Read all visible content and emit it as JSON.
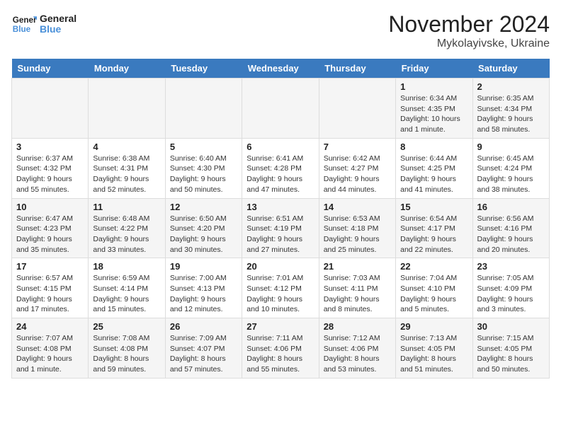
{
  "logo": {
    "text_general": "General",
    "text_blue": "Blue"
  },
  "header": {
    "month": "November 2024",
    "location": "Mykolayivske, Ukraine"
  },
  "days_of_week": [
    "Sunday",
    "Monday",
    "Tuesday",
    "Wednesday",
    "Thursday",
    "Friday",
    "Saturday"
  ],
  "weeks": [
    [
      {
        "day": "",
        "info": ""
      },
      {
        "day": "",
        "info": ""
      },
      {
        "day": "",
        "info": ""
      },
      {
        "day": "",
        "info": ""
      },
      {
        "day": "",
        "info": ""
      },
      {
        "day": "1",
        "info": "Sunrise: 6:34 AM\nSunset: 4:35 PM\nDaylight: 10 hours and 1 minute."
      },
      {
        "day": "2",
        "info": "Sunrise: 6:35 AM\nSunset: 4:34 PM\nDaylight: 9 hours and 58 minutes."
      }
    ],
    [
      {
        "day": "3",
        "info": "Sunrise: 6:37 AM\nSunset: 4:32 PM\nDaylight: 9 hours and 55 minutes."
      },
      {
        "day": "4",
        "info": "Sunrise: 6:38 AM\nSunset: 4:31 PM\nDaylight: 9 hours and 52 minutes."
      },
      {
        "day": "5",
        "info": "Sunrise: 6:40 AM\nSunset: 4:30 PM\nDaylight: 9 hours and 50 minutes."
      },
      {
        "day": "6",
        "info": "Sunrise: 6:41 AM\nSunset: 4:28 PM\nDaylight: 9 hours and 47 minutes."
      },
      {
        "day": "7",
        "info": "Sunrise: 6:42 AM\nSunset: 4:27 PM\nDaylight: 9 hours and 44 minutes."
      },
      {
        "day": "8",
        "info": "Sunrise: 6:44 AM\nSunset: 4:25 PM\nDaylight: 9 hours and 41 minutes."
      },
      {
        "day": "9",
        "info": "Sunrise: 6:45 AM\nSunset: 4:24 PM\nDaylight: 9 hours and 38 minutes."
      }
    ],
    [
      {
        "day": "10",
        "info": "Sunrise: 6:47 AM\nSunset: 4:23 PM\nDaylight: 9 hours and 35 minutes."
      },
      {
        "day": "11",
        "info": "Sunrise: 6:48 AM\nSunset: 4:22 PM\nDaylight: 9 hours and 33 minutes."
      },
      {
        "day": "12",
        "info": "Sunrise: 6:50 AM\nSunset: 4:20 PM\nDaylight: 9 hours and 30 minutes."
      },
      {
        "day": "13",
        "info": "Sunrise: 6:51 AM\nSunset: 4:19 PM\nDaylight: 9 hours and 27 minutes."
      },
      {
        "day": "14",
        "info": "Sunrise: 6:53 AM\nSunset: 4:18 PM\nDaylight: 9 hours and 25 minutes."
      },
      {
        "day": "15",
        "info": "Sunrise: 6:54 AM\nSunset: 4:17 PM\nDaylight: 9 hours and 22 minutes."
      },
      {
        "day": "16",
        "info": "Sunrise: 6:56 AM\nSunset: 4:16 PM\nDaylight: 9 hours and 20 minutes."
      }
    ],
    [
      {
        "day": "17",
        "info": "Sunrise: 6:57 AM\nSunset: 4:15 PM\nDaylight: 9 hours and 17 minutes."
      },
      {
        "day": "18",
        "info": "Sunrise: 6:59 AM\nSunset: 4:14 PM\nDaylight: 9 hours and 15 minutes."
      },
      {
        "day": "19",
        "info": "Sunrise: 7:00 AM\nSunset: 4:13 PM\nDaylight: 9 hours and 12 minutes."
      },
      {
        "day": "20",
        "info": "Sunrise: 7:01 AM\nSunset: 4:12 PM\nDaylight: 9 hours and 10 minutes."
      },
      {
        "day": "21",
        "info": "Sunrise: 7:03 AM\nSunset: 4:11 PM\nDaylight: 9 hours and 8 minutes."
      },
      {
        "day": "22",
        "info": "Sunrise: 7:04 AM\nSunset: 4:10 PM\nDaylight: 9 hours and 5 minutes."
      },
      {
        "day": "23",
        "info": "Sunrise: 7:05 AM\nSunset: 4:09 PM\nDaylight: 9 hours and 3 minutes."
      }
    ],
    [
      {
        "day": "24",
        "info": "Sunrise: 7:07 AM\nSunset: 4:08 PM\nDaylight: 9 hours and 1 minute."
      },
      {
        "day": "25",
        "info": "Sunrise: 7:08 AM\nSunset: 4:08 PM\nDaylight: 8 hours and 59 minutes."
      },
      {
        "day": "26",
        "info": "Sunrise: 7:09 AM\nSunset: 4:07 PM\nDaylight: 8 hours and 57 minutes."
      },
      {
        "day": "27",
        "info": "Sunrise: 7:11 AM\nSunset: 4:06 PM\nDaylight: 8 hours and 55 minutes."
      },
      {
        "day": "28",
        "info": "Sunrise: 7:12 AM\nSunset: 4:06 PM\nDaylight: 8 hours and 53 minutes."
      },
      {
        "day": "29",
        "info": "Sunrise: 7:13 AM\nSunset: 4:05 PM\nDaylight: 8 hours and 51 minutes."
      },
      {
        "day": "30",
        "info": "Sunrise: 7:15 AM\nSunset: 4:05 PM\nDaylight: 8 hours and 50 minutes."
      }
    ]
  ]
}
